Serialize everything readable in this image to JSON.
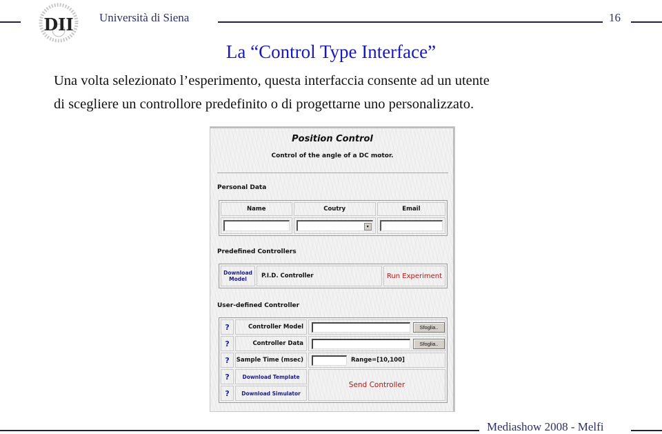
{
  "header": {
    "institution": "Università di Siena",
    "page_number": "16",
    "logo_icon": "dii-logo-icon"
  },
  "slide": {
    "title": "La “Control Type Interface”",
    "paragraph_line1": "Una volta selezionato l’esperimento, questa interfaccia consente ad un utente",
    "paragraph_line2": "di scegliere un controllore predefinito o di progettarne uno personalizzato."
  },
  "footer": {
    "text": "Mediashow 2008 - Melfi"
  },
  "app": {
    "title": "Position Control",
    "subtitle": "Control of the angle of a DC motor.",
    "personal_data": {
      "label": "Personal Data",
      "columns": [
        "Name",
        "Coutry",
        "Email"
      ],
      "name_value": "",
      "country_selected": "",
      "email_value": "",
      "dropdown_icon": "▾"
    },
    "predefined": {
      "label": "Predefined Controllers",
      "download_model_line1": "Download",
      "download_model_line2": "Model",
      "controller_name": "P.I.D. Controller",
      "run_label": "Run Experiment"
    },
    "user_defined": {
      "label": "User-defined Controller",
      "help_icon": "?",
      "rows": [
        {
          "label": "Controller Model",
          "value": "",
          "browse_label": "Sfoglia.."
        },
        {
          "label": "Controller Data",
          "value": "",
          "browse_label": "Sfoglia.."
        },
        {
          "label": "Sample Time (msec)",
          "value": "",
          "range_text": "Range=[10,100]"
        }
      ],
      "download_template": "Download Template",
      "download_simulator": "Download Simulator",
      "send_label": "Send Controller"
    }
  },
  "colors": {
    "title_blue": "#1717c4",
    "header_navy": "#2b2f63",
    "link_blue": "#1a1a8c",
    "action_red": "#b01818"
  }
}
